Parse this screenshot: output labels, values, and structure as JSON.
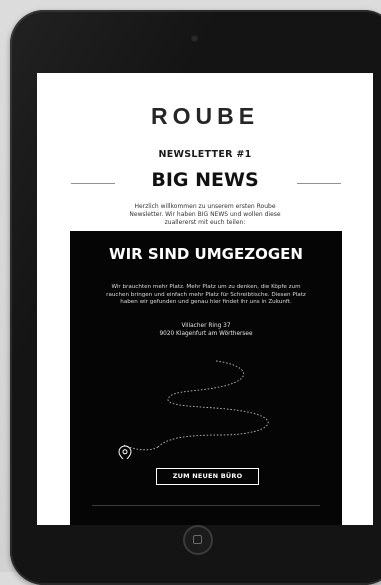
{
  "brand": {
    "logo_text": "ROUBE"
  },
  "newsletter": {
    "label": "NEWSLETTER #1",
    "headline": "BIG NEWS",
    "intro": "Herzlich willkommen zu unserem ersten Roube Newsletter. Wir haben BIG NEWS und wollen diese zuallererst mit euch teilen:"
  },
  "moved_section": {
    "title": "WIR SIND UMGEZOGEN",
    "body": "Wir brauchten mehr Platz. Mehr Platz um zu denken, die Köpfe zum rauchen bringen und einfach mehr Platz für Schreibtische. Diesen Platz haben wir gefunden und genau hier findet ihr uns in Zukunft.",
    "address_line1": "Villacher Ring 37",
    "address_line2": "9020 Klagenfurt am Wörthersee",
    "cta_label": "ZUM NEUEN BÜRO"
  },
  "icons": {
    "location": "location-pin-icon",
    "home": "home-button-icon"
  },
  "colors": {
    "device_body": "#141414",
    "screen_bg": "#ffffff",
    "dark_block": "#050505",
    "accent_rule": "#8c8fb0",
    "text_dark": "#111111",
    "text_light": "#ffffff"
  }
}
